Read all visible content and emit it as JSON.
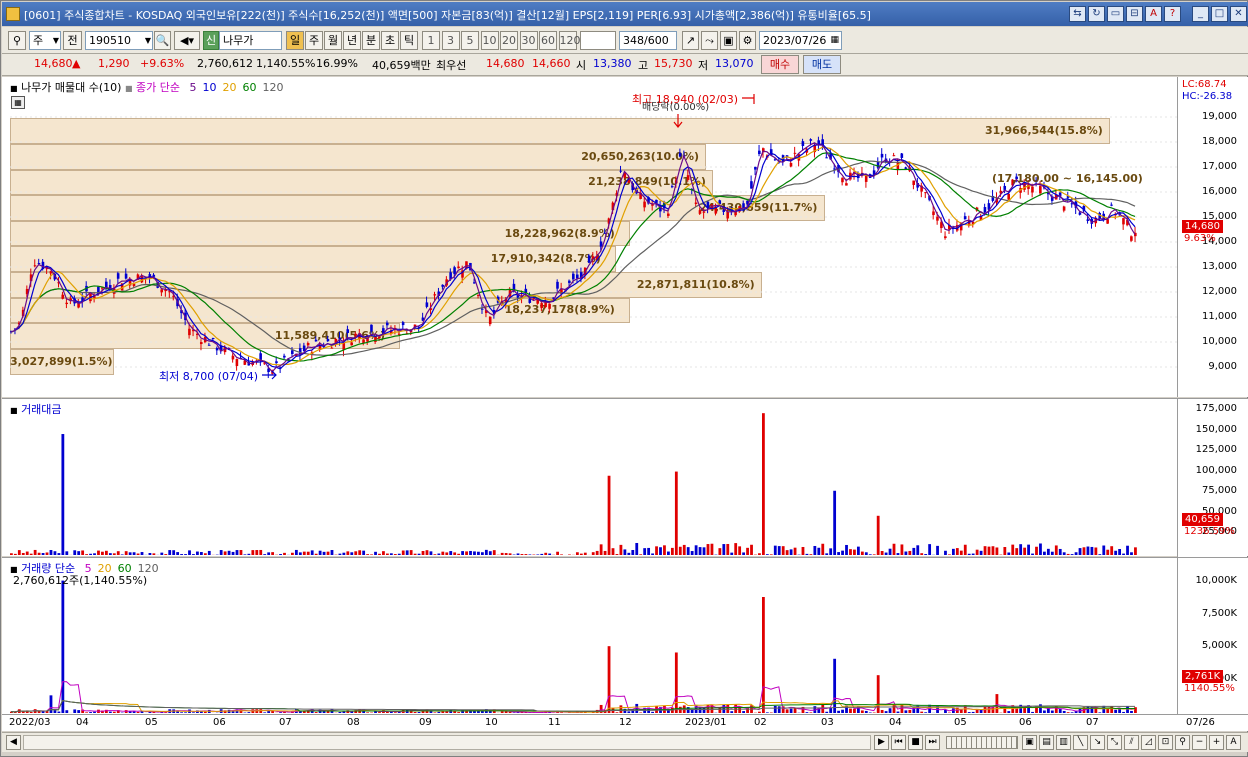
{
  "window": {
    "title": "[0601] 주식종합차트 - KOSDAQ 외국인보유[222(천)] 주식수[16,252(천)] 액면[500] 자본금[83(억)] 결산[12월] EPS[2,119] PER[6.93] 시가총액[2,386(억)] 유통비율[65.5]"
  },
  "toolbar": {
    "period_select": "주",
    "prev_label": "전",
    "code": "190510",
    "name": "나무가",
    "new_badge": "신",
    "period_buttons": [
      "일",
      "주",
      "월",
      "년",
      "분",
      "초",
      "틱"
    ],
    "n_buttons": [
      "1",
      "3",
      "5",
      "10",
      "20",
      "30",
      "60",
      "120"
    ],
    "count": "348",
    "count_total": "/600",
    "date": "2023/07/26"
  },
  "quote": {
    "price": "14,680",
    "arrow": "▲",
    "change": "1,290",
    "change_pct": "+9.63%",
    "volume": "2,760,612",
    "volume_pct": "1,140.55%",
    "turnover": "16.99%",
    "amount": "40,659백만",
    "best_label": "최우선",
    "ask": "14,680",
    "bid": "14,660",
    "open_label": "시",
    "open": "13,380",
    "high_label": "고",
    "high": "15,730",
    "low_label": "저",
    "low": "13,070",
    "buy_label": "매수",
    "sell_label": "매도"
  },
  "price_panel": {
    "legend_name": "나무가 매물대 수(10)",
    "legend_ma": "종가 단순",
    "ma_periods": [
      "5",
      "10",
      "20",
      "60",
      "120"
    ],
    "ma_colors": [
      "#6a0a8a",
      "#0000d0",
      "#e0a000",
      "#008000",
      "#606060"
    ],
    "lc": "LC:68.74",
    "hc": "HC:-26.38",
    "yticks": [
      "19,000",
      "18,000",
      "17,000",
      "16,000",
      "15,000",
      "14,000",
      "13,000",
      "12,000",
      "11,000",
      "10,000",
      "9,000"
    ],
    "last_price": "14,680",
    "last_pct": "9.63%",
    "annotations": {
      "high": "최고 18,940 (02/03)",
      "dividend": "배당락(0.00%)",
      "low": "최저 8,700 (07/04)",
      "range": "(17,180.00 ~ 16,145.00)"
    },
    "volume_profile": [
      {
        "label": "31,966,544(15.8%)",
        "pct": 15.8
      },
      {
        "label": "20,650,263(10.0%)",
        "pct": 10.0
      },
      {
        "label": "21,238,849(10.1%)",
        "pct": 10.1
      },
      {
        "label": "24,430,659(11.7%)",
        "pct": 11.7
      },
      {
        "label": "18,228,962(8.9%)",
        "pct": 8.9
      },
      {
        "label": "17,910,342(8.7%)",
        "pct": 8.7
      },
      {
        "label": "22,871,811(10.8%)",
        "pct": 10.8
      },
      {
        "label": "18,237,178(8.9%)",
        "pct": 8.9
      },
      {
        "label": "11,589,410(5.6%)",
        "pct": 5.6
      },
      {
        "label": "3,027,899(1.5%)",
        "pct": 1.5
      }
    ]
  },
  "amount_panel": {
    "legend": "거래대금",
    "yticks": [
      "175,000",
      "150,000",
      "125,000",
      "100,000",
      "75,000",
      "50,000",
      "25,000"
    ],
    "last_value": "40,659",
    "last_pct": "1236.59%"
  },
  "volume_panel": {
    "legend": "거래량 단순",
    "ma_periods": [
      "5",
      "20",
      "60",
      "120"
    ],
    "ma_colors": [
      "#c000c0",
      "#e0a000",
      "#008000",
      "#606060"
    ],
    "subtitle": "2,760,612주(1,140.55%)",
    "yticks": [
      "10,000K",
      "7,500K",
      "5,000K",
      "2,500K"
    ],
    "last_value": "2,761K",
    "last_pct": "1140.55%"
  },
  "x_axis": {
    "labels": [
      "2022/03",
      "04",
      "05",
      "06",
      "07",
      "08",
      "09",
      "10",
      "11",
      "12",
      "2023/01",
      "02",
      "03",
      "04",
      "05",
      "06",
      "07"
    ],
    "end_label": "07/26"
  },
  "colors": {
    "up": "#e00000",
    "down": "#0000d0",
    "profile_fill": "#f5e6cf",
    "title_bar": "#3560a8"
  }
}
